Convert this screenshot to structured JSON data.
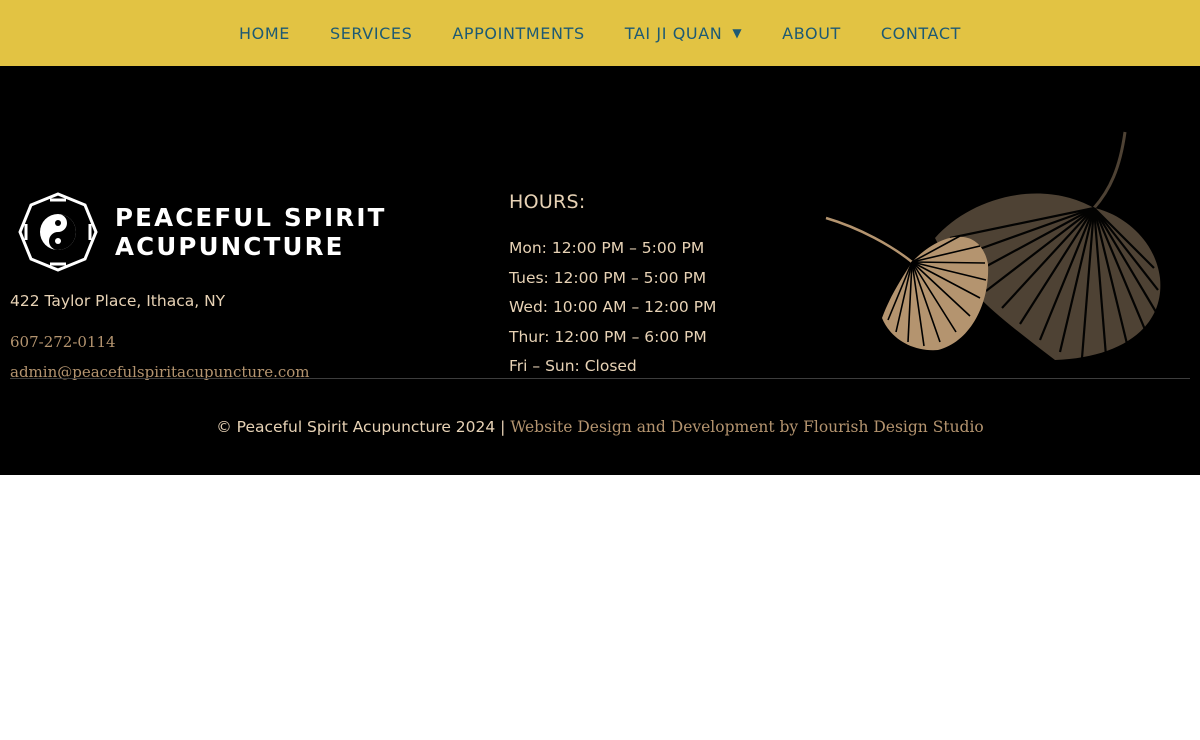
{
  "nav": {
    "items": [
      {
        "label": "HOME"
      },
      {
        "label": "SERVICES"
      },
      {
        "label": "APPOINTMENTS"
      },
      {
        "label": "TAI JI QUAN",
        "has_dropdown": true
      },
      {
        "label": "ABOUT"
      },
      {
        "label": "CONTACT"
      }
    ],
    "dropdown_icon": "caret-down-icon"
  },
  "footer": {
    "logo": {
      "icon": "bagua-yin-yang-icon",
      "line1": "PEACEFUL SPIRIT",
      "line2": "ACUPUNCTURE"
    },
    "address": "422 Taylor Place, Ithaca, NY",
    "phone": "607-272-0114",
    "email": "admin@peacefulspiritacupuncture.com",
    "hours_title": "HOURS:",
    "hours": [
      "Mon: 12:00 PM – 5:00 PM",
      "Tues: 12:00 PM – 5:00 PM",
      "Wed: 10:00 AM – 12:00 PM",
      "Thur: 12:00 PM – 6:00 PM",
      "Fri – Sun: Closed"
    ],
    "decor_icon": "ginkgo-leaves-icon",
    "copyright": "© Peaceful Spirit Acupuncture 2024 |",
    "credit_link": "Website Design and Development by Flourish Design Studio"
  },
  "colors": {
    "nav_bg": "#e2c343",
    "nav_text": "#1d5a74",
    "footer_bg": "#000000",
    "footer_text": "#e7d2b5",
    "link": "#b4946f"
  }
}
